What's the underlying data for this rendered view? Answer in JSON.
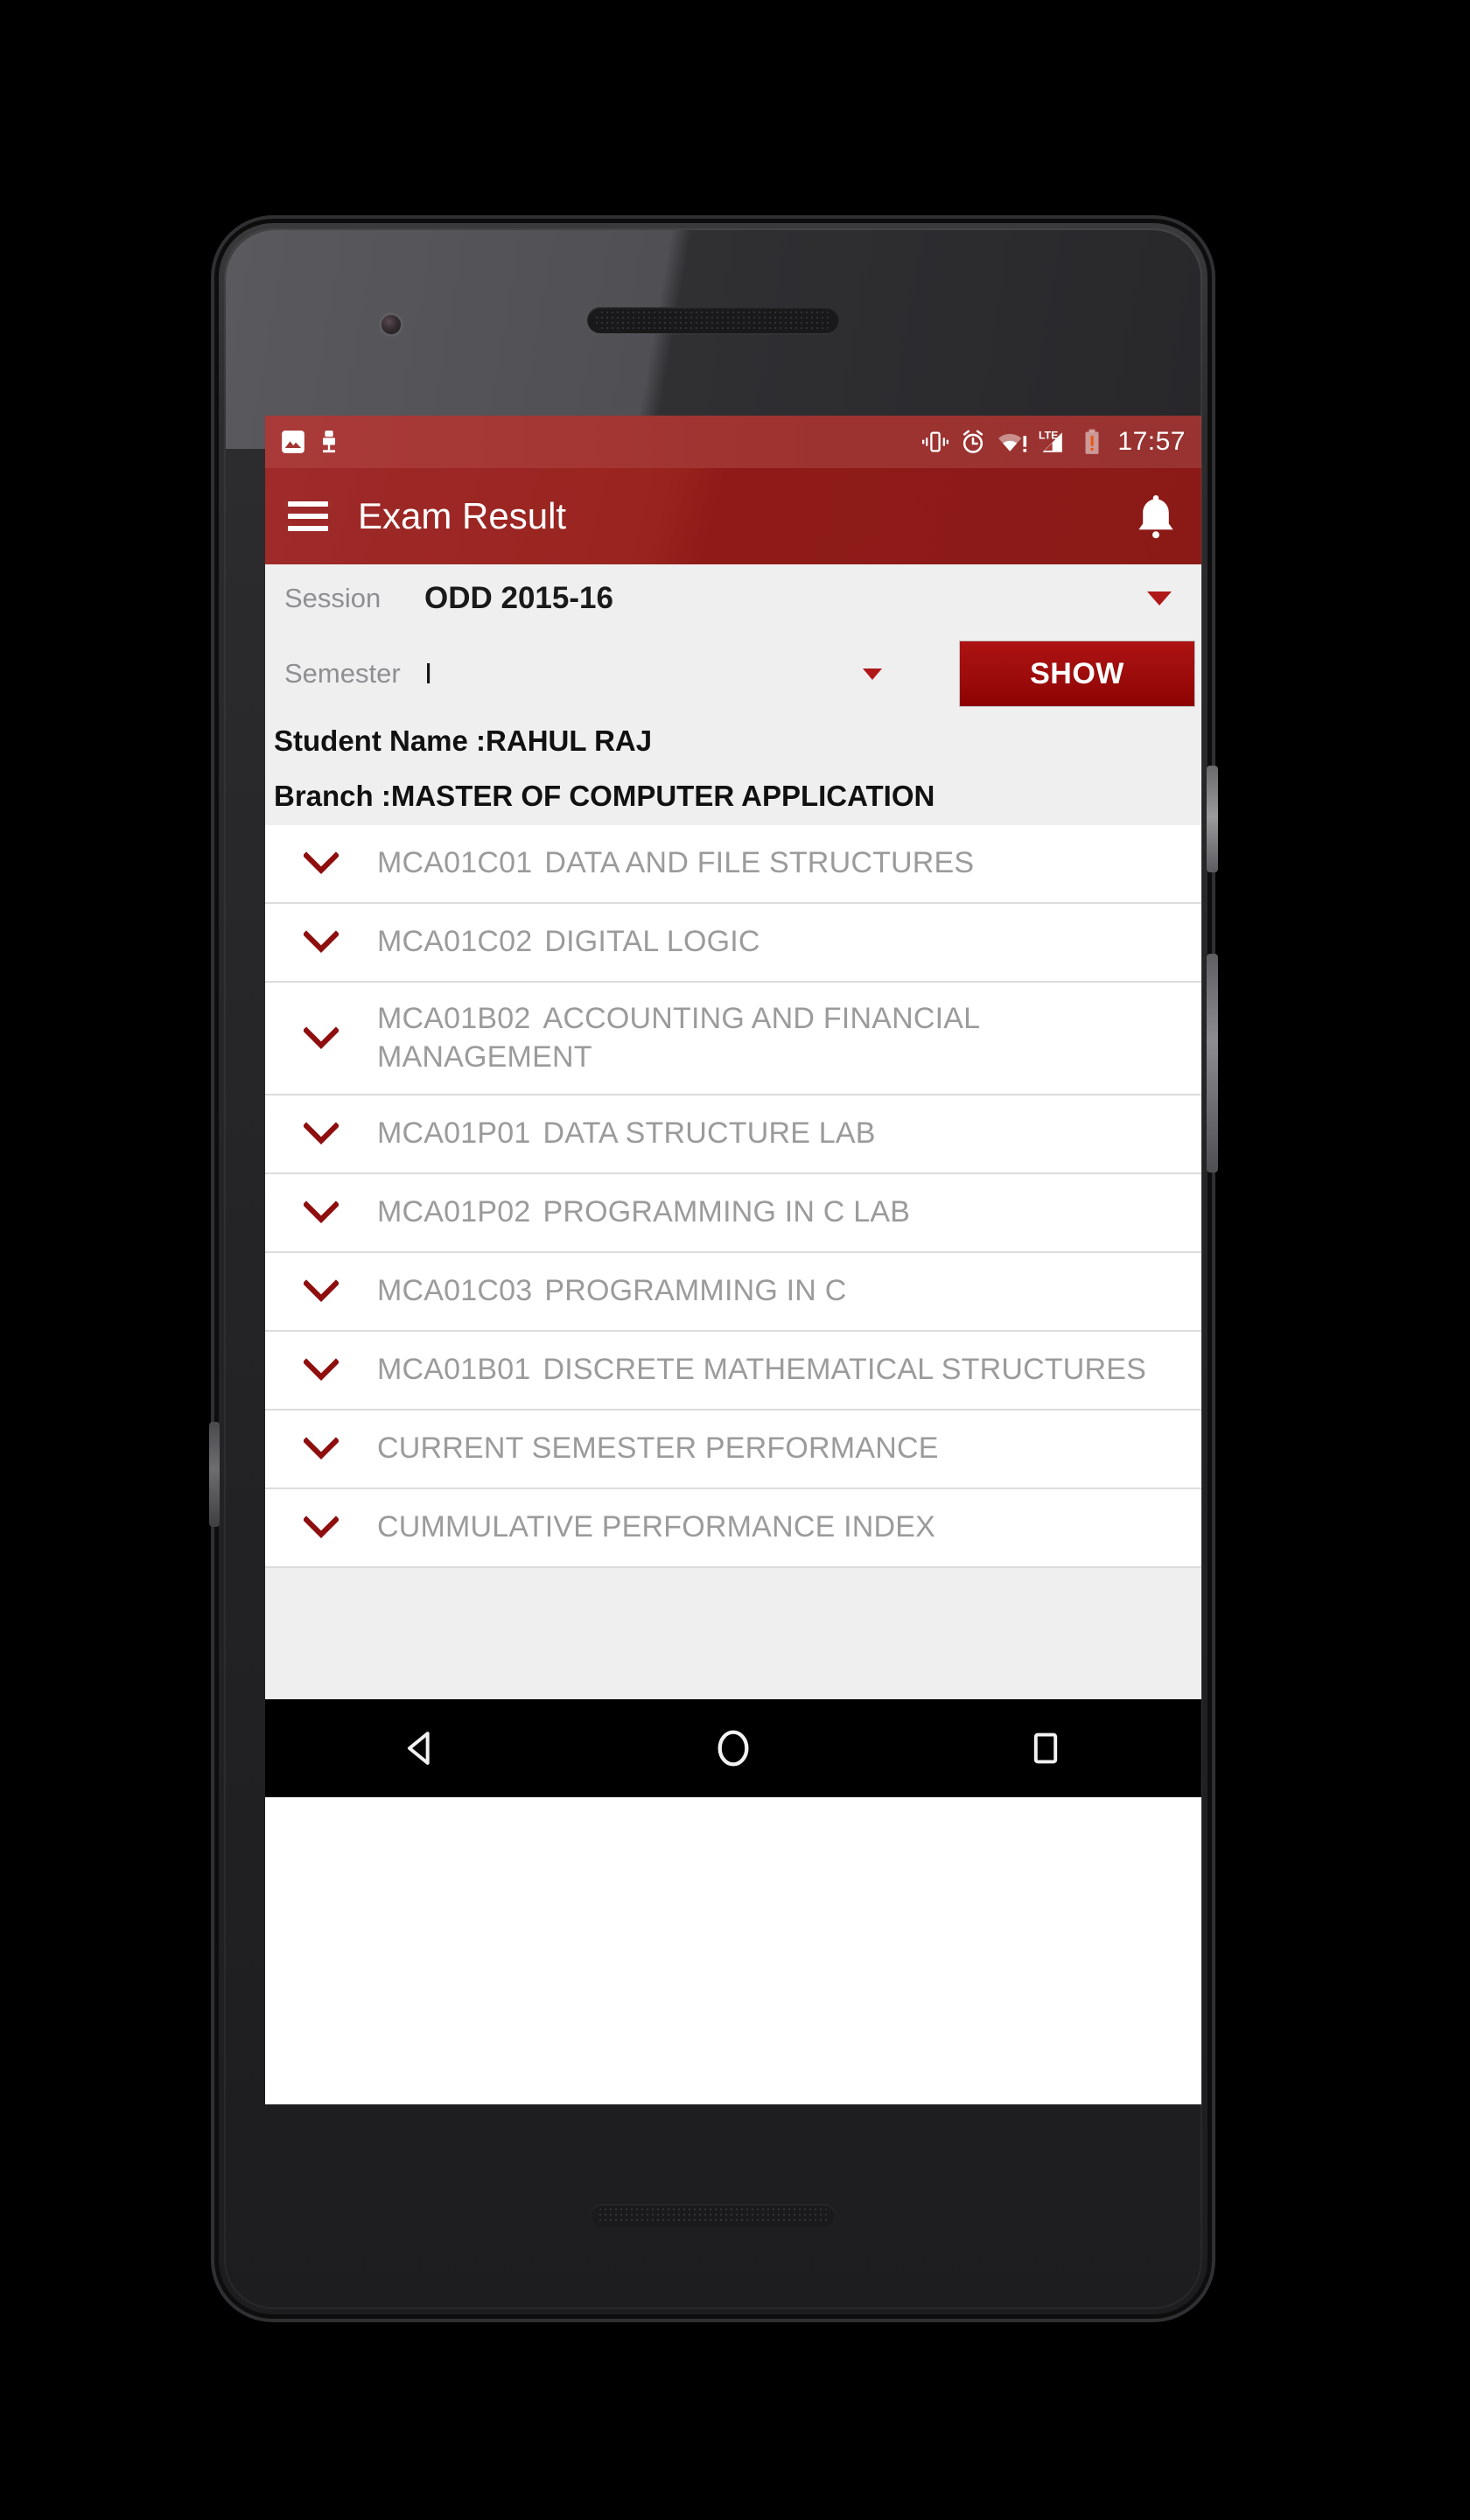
{
  "status_bar": {
    "left_icons": [
      "image-icon",
      "usb-debugging-icon"
    ],
    "right_icons": [
      "vibrate-icon",
      "alarm-icon",
      "wifi-warning-icon",
      "lte-signal-icon",
      "battery-warning-icon"
    ],
    "lte_label": "LTE",
    "time": "17:57"
  },
  "app_bar": {
    "menu_icon": "hamburger-menu-icon",
    "title": "Exam Result",
    "action_icon": "notification-bell-icon"
  },
  "form": {
    "session_label": "Session",
    "session_value": "ODD 2015-16",
    "session_caret": "dropdown-caret-icon",
    "semester_label": "Semester",
    "semester_value": "I",
    "semester_caret": "dropdown-caret-icon",
    "show_button": "SHOW",
    "student_name_label": "Student Name  : ",
    "student_name_value": "RAHUL RAJ",
    "branch_label": "Branch : ",
    "branch_value": "MASTER OF COMPUTER APPLICATION"
  },
  "courses": [
    {
      "code": "MCA01C01",
      "name": "DATA AND FILE STRUCTURES"
    },
    {
      "code": "MCA01C02",
      "name": "DIGITAL LOGIC"
    },
    {
      "code": "MCA01B02",
      "name": "ACCOUNTING AND FINANCIAL MANAGEMENT"
    },
    {
      "code": "MCA01P01",
      "name": "DATA STRUCTURE LAB"
    },
    {
      "code": "MCA01P02",
      "name": "PROGRAMMING IN C LAB"
    },
    {
      "code": "MCA01C03",
      "name": "PROGRAMMING IN C"
    },
    {
      "code": "MCA01B01",
      "name": "DISCRETE MATHEMATICAL STRUCTURES"
    },
    {
      "code": "",
      "name": "CURRENT SEMESTER PERFORMANCE"
    },
    {
      "code": "",
      "name": "CUMMULATIVE PERFORMANCE INDEX"
    }
  ],
  "nav_bar": {
    "back": "back-triangle-icon",
    "home": "home-circle-icon",
    "recents": "recents-square-icon"
  },
  "colors": {
    "status_bar": "#a33633",
    "app_bar": "#931f1c",
    "accent_red": "#b01919",
    "button_red": "#9d0c0c",
    "panel_gray": "#efeff0",
    "list_text_gray": "#9b9b9b"
  }
}
